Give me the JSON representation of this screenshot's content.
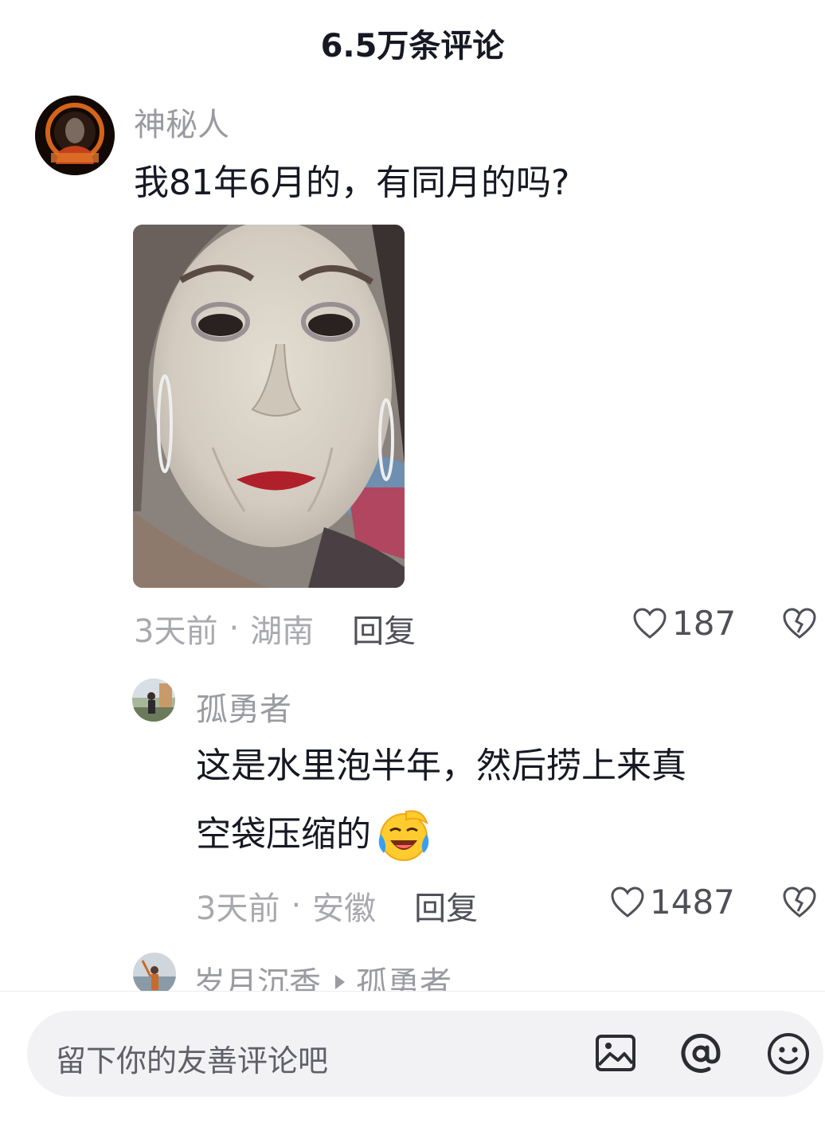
{
  "header": {
    "title": "6.5万条评论"
  },
  "comments": [
    {
      "username": "神秘人",
      "text": "我81年6月的，有同月的吗?",
      "time": "3天前",
      "location": "湖南",
      "reply_label": "回复",
      "likes": "187",
      "avatar_icon": "dark-portrait-avatar"
    },
    {
      "username": "孤勇者",
      "text_line1": "这是水里泡半年，然后捞上来真",
      "text_line2": "空袋压缩的",
      "emoji": "laughing-crying-emoji",
      "time": "3天前",
      "location": "安徽",
      "reply_label": "回复",
      "likes": "1487",
      "avatar_icon": "person-outdoor-avatar"
    }
  ],
  "reply_preview": {
    "username": "岁月沉香",
    "reply_to": "孤勇者"
  },
  "composer": {
    "placeholder": "留下你的友善评论吧",
    "icons": [
      "image-icon",
      "at-icon",
      "emoji-icon"
    ]
  },
  "colors": {
    "text": "#161823",
    "muted": "#a8a9ae",
    "input_bg": "#f2f2f4"
  }
}
